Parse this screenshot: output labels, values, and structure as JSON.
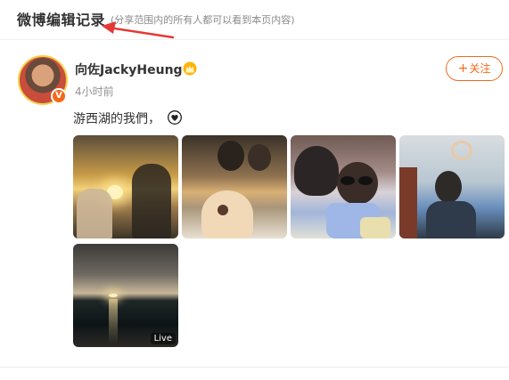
{
  "header": {
    "title": "微博编辑记录",
    "note": "(分享范围内的所有人都可以看到本页内容)"
  },
  "post": {
    "author": "向佐JackyHeung",
    "time": "4小时前",
    "text": "游西湖的我們，",
    "follow_label": "关注",
    "follow_plus": "+",
    "verified_mark": "V",
    "photos": [
      {
        "alt": "sunset-heart-hands"
      },
      {
        "alt": "family-selfie-child"
      },
      {
        "alt": "mother-daughter-sunglasses"
      },
      {
        "alt": "raised-heart-hands"
      },
      {
        "alt": "lake-sunset",
        "badge": "Live"
      }
    ]
  },
  "icons": {
    "crown": "crown-icon",
    "heart": "heart-icon",
    "arrow": "red-arrow-annotation"
  },
  "colors": {
    "accent": "#f26a1b",
    "arrow": "#e53935"
  }
}
